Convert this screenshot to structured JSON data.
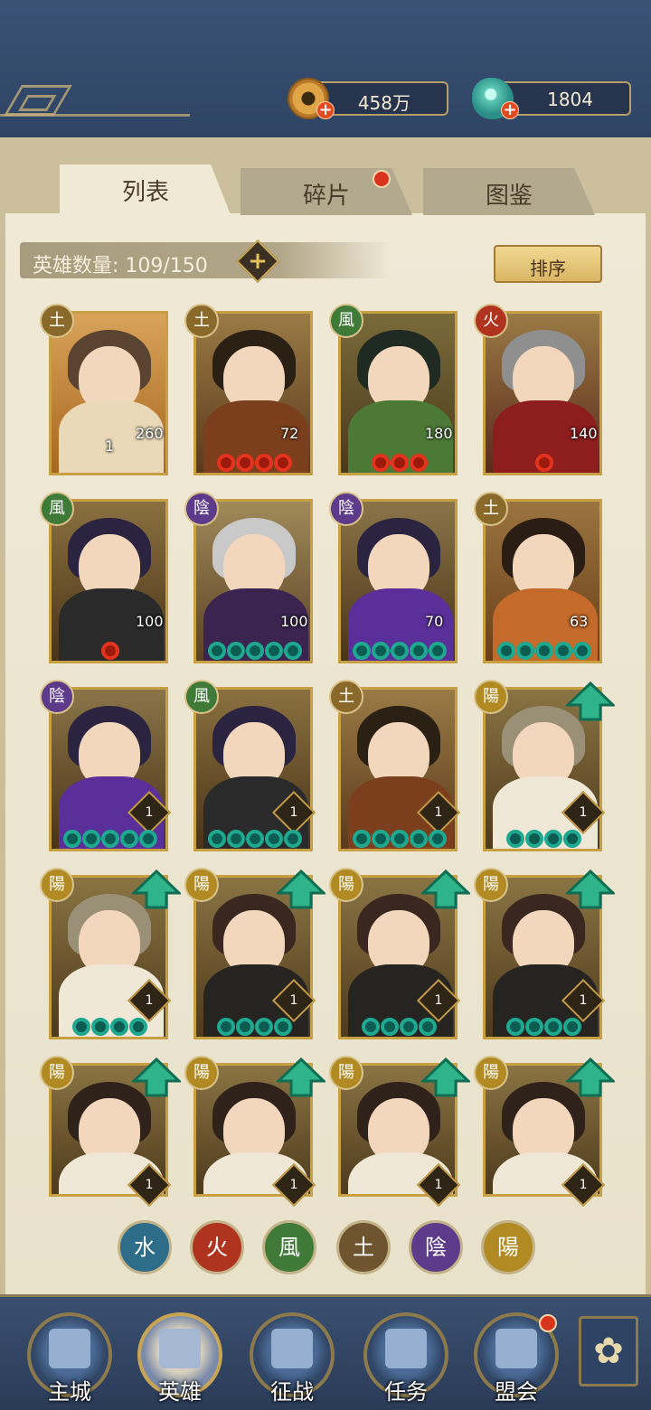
{
  "currency": {
    "coins": "458万",
    "jade": "1804"
  },
  "tabs": [
    "列表",
    "碎片",
    "图鉴"
  ],
  "hero_count_text": "英雄数量: 109/150",
  "sort_label": "排序",
  "elements": {
    "土": "#8a6a2a",
    "風": "#3f7a38",
    "火": "#b0331f",
    "陰": "#5d3a8a",
    "陽": "#b28a23",
    "水": "#2d6d8a"
  },
  "heroes": [
    {
      "elem": "土",
      "level": "260",
      "star": "1",
      "stars": [],
      "tone": "gold"
    },
    {
      "elem": "土",
      "level": "72",
      "star": "",
      "stars": [
        "red",
        "red",
        "red",
        "red"
      ],
      "tone": "warrior"
    },
    {
      "elem": "風",
      "level": "180",
      "star": "",
      "stars": [
        "red",
        "red",
        "red"
      ],
      "tone": "green"
    },
    {
      "elem": "火",
      "level": "140",
      "star": "",
      "stars": [
        "red"
      ],
      "tone": "red"
    },
    {
      "elem": "風",
      "level": "100",
      "star": "",
      "stars": [
        "red"
      ],
      "tone": "greenlady"
    },
    {
      "elem": "陰",
      "level": "100",
      "star": "",
      "stars": [
        "teal",
        "teal",
        "teal",
        "teal",
        "teal"
      ],
      "tone": "purple"
    },
    {
      "elem": "陰",
      "level": "70",
      "star": "",
      "stars": [
        "teal",
        "teal",
        "teal",
        "teal",
        "teal"
      ],
      "tone": "purple2"
    },
    {
      "elem": "土",
      "level": "63",
      "star": "",
      "stars": [
        "teal",
        "teal",
        "teal",
        "teal",
        "teal"
      ],
      "tone": "fox"
    },
    {
      "elem": "陰",
      "level": "1",
      "star": "",
      "stars": [
        "teal",
        "teal",
        "teal",
        "teal",
        "teal"
      ],
      "tone": "purple2",
      "diamond": true
    },
    {
      "elem": "風",
      "level": "1",
      "star": "",
      "stars": [
        "teal",
        "teal",
        "teal",
        "teal",
        "teal"
      ],
      "tone": "greenlady",
      "diamond": true
    },
    {
      "elem": "土",
      "level": "1",
      "star": "",
      "stars": [
        "teal",
        "teal",
        "teal",
        "teal",
        "teal"
      ],
      "tone": "warrior",
      "diamond": true
    },
    {
      "elem": "陽",
      "level": "1",
      "star": "",
      "stars": [
        "teal",
        "teal",
        "teal",
        "teal"
      ],
      "tone": "white",
      "diamond": true,
      "up": true
    },
    {
      "elem": "陽",
      "level": "1",
      "star": "",
      "stars": [
        "teal",
        "teal",
        "teal",
        "teal"
      ],
      "tone": "white",
      "diamond": true,
      "up": true
    },
    {
      "elem": "陽",
      "level": "1",
      "star": "",
      "stars": [
        "teal",
        "teal",
        "teal",
        "teal"
      ],
      "tone": "dark",
      "diamond": true,
      "up": true
    },
    {
      "elem": "陽",
      "level": "1",
      "star": "",
      "stars": [
        "teal",
        "teal",
        "teal",
        "teal"
      ],
      "tone": "dark",
      "diamond": true,
      "up": true
    },
    {
      "elem": "陽",
      "level": "1",
      "star": "",
      "stars": [
        "teal",
        "teal",
        "teal",
        "teal"
      ],
      "tone": "dark",
      "diamond": true,
      "up": true
    },
    {
      "elem": "陽",
      "level": "1",
      "star": "",
      "stars": [],
      "tone": "lady",
      "diamond": true,
      "up": true
    },
    {
      "elem": "陽",
      "level": "1",
      "star": "",
      "stars": [],
      "tone": "lady",
      "diamond": true,
      "up": true
    },
    {
      "elem": "陽",
      "level": "1",
      "star": "",
      "stars": [],
      "tone": "lady",
      "diamond": true,
      "up": true
    },
    {
      "elem": "陽",
      "level": "1",
      "star": "",
      "stars": [],
      "tone": "lady",
      "diamond": true,
      "up": true
    }
  ],
  "filters": [
    {
      "label": "水",
      "color": "#2d6d8a"
    },
    {
      "label": "火",
      "color": "#b0331f"
    },
    {
      "label": "風",
      "color": "#3f7a38"
    },
    {
      "label": "土",
      "color": "#6e5530"
    },
    {
      "label": "陰",
      "color": "#5d3a8a"
    },
    {
      "label": "陽",
      "color": "#b28a23"
    }
  ],
  "nav": [
    "主城",
    "英雄",
    "征战",
    "任务",
    "盟会"
  ]
}
